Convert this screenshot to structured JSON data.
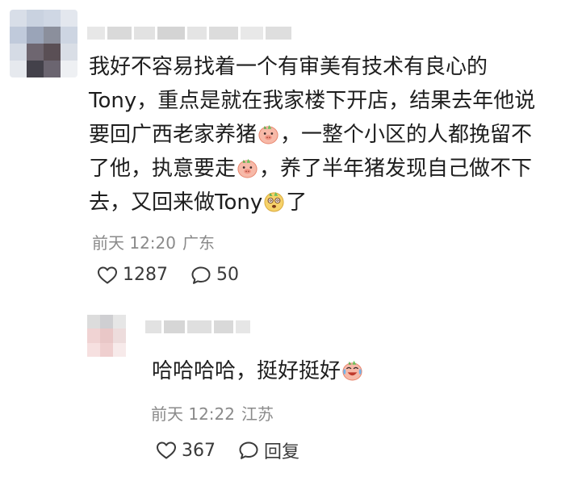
{
  "comment": {
    "text_line1": "我好不容易找着一个有审美有技术有良心的",
    "text_line2": "Tony，重点是就在我家楼下开店，结果去年他说",
    "text_line3_a": "要回广西老家养猪",
    "text_line3_b": "，一整个小区的人都挽留不",
    "text_line4_a": "了他，执意要走",
    "text_line4_b": "，养了半年猪发现自己做不下",
    "text_line5_a": "去，又回来做Tony",
    "text_line5_b": "了",
    "time": "前天 12:20",
    "location": "广东",
    "like_count": "1287",
    "reply_count": "50"
  },
  "reply": {
    "text": "哈哈哈哈，挺好挺好",
    "time": "前天 12:22",
    "location": "江苏",
    "like_count": "367",
    "reply_label": "回复"
  },
  "icons": {
    "like": "heart-outline-icon",
    "comment": "speech-bubble-icon",
    "emoji_pig": "pig-emoji",
    "emoji_dizzy": "dizzy-face-emoji",
    "emoji_laugh_cry": "laugh-cry-emoji"
  },
  "colors": {
    "text": "#1e1e1e",
    "meta": "#8a8a8a",
    "action": "#3a3a3a"
  }
}
